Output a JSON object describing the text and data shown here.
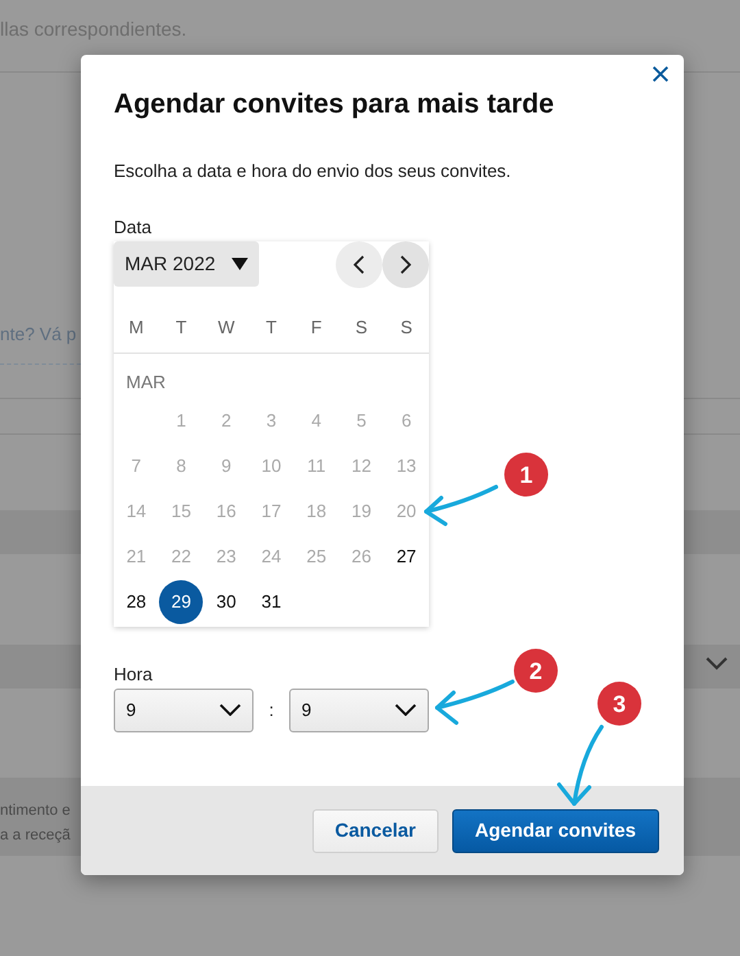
{
  "background": {
    "texts": [
      "llas correspondientes.",
      "nte? Vá p",
      "ntimento e",
      "a a receçã"
    ]
  },
  "dialog": {
    "title": "Agendar convites para mais tarde",
    "description": "Escolha a data e hora do envio dos seus convites.",
    "date_label": "Data",
    "calendar": {
      "month_button": "MAR 2022",
      "weekdays": [
        "M",
        "T",
        "W",
        "T",
        "F",
        "S",
        "S"
      ],
      "month_label": "MAR",
      "weeks": [
        [
          {
            "day": "1",
            "enabled": false,
            "selected": false
          },
          {
            "day": "2",
            "enabled": false,
            "selected": false
          },
          {
            "day": "3",
            "enabled": false,
            "selected": false
          },
          {
            "day": "4",
            "enabled": false,
            "selected": false
          },
          {
            "day": "5",
            "enabled": false,
            "selected": false
          },
          {
            "day": "6",
            "enabled": false,
            "selected": false
          }
        ],
        [
          {
            "day": "7",
            "enabled": false,
            "selected": false
          },
          {
            "day": "8",
            "enabled": false,
            "selected": false
          },
          {
            "day": "9",
            "enabled": false,
            "selected": false
          },
          {
            "day": "10",
            "enabled": false,
            "selected": false
          },
          {
            "day": "11",
            "enabled": false,
            "selected": false
          },
          {
            "day": "12",
            "enabled": false,
            "selected": false
          },
          {
            "day": "13",
            "enabled": false,
            "selected": false
          }
        ],
        [
          {
            "day": "14",
            "enabled": false,
            "selected": false
          },
          {
            "day": "15",
            "enabled": false,
            "selected": false
          },
          {
            "day": "16",
            "enabled": false,
            "selected": false
          },
          {
            "day": "17",
            "enabled": false,
            "selected": false
          },
          {
            "day": "18",
            "enabled": false,
            "selected": false
          },
          {
            "day": "19",
            "enabled": false,
            "selected": false
          },
          {
            "day": "20",
            "enabled": false,
            "selected": false
          }
        ],
        [
          {
            "day": "21",
            "enabled": false,
            "selected": false
          },
          {
            "day": "22",
            "enabled": false,
            "selected": false
          },
          {
            "day": "23",
            "enabled": false,
            "selected": false
          },
          {
            "day": "24",
            "enabled": false,
            "selected": false
          },
          {
            "day": "25",
            "enabled": false,
            "selected": false
          },
          {
            "day": "26",
            "enabled": false,
            "selected": false
          },
          {
            "day": "27",
            "enabled": true,
            "selected": false
          }
        ],
        [
          {
            "day": "28",
            "enabled": true,
            "selected": false
          },
          {
            "day": "29",
            "enabled": true,
            "selected": true
          },
          {
            "day": "30",
            "enabled": true,
            "selected": false
          },
          {
            "day": "31",
            "enabled": true,
            "selected": false
          }
        ]
      ]
    },
    "time_label": "Hora",
    "hour": {
      "value": "9"
    },
    "separator": ":",
    "minute": {
      "value": "9"
    },
    "buttons": [
      {
        "label": "Cancelar",
        "kind": "secondary"
      },
      {
        "label": "Agendar convites",
        "kind": "primary"
      }
    ]
  },
  "annotations": [
    {
      "number": "1"
    },
    {
      "number": "2"
    },
    {
      "number": "3"
    }
  ]
}
